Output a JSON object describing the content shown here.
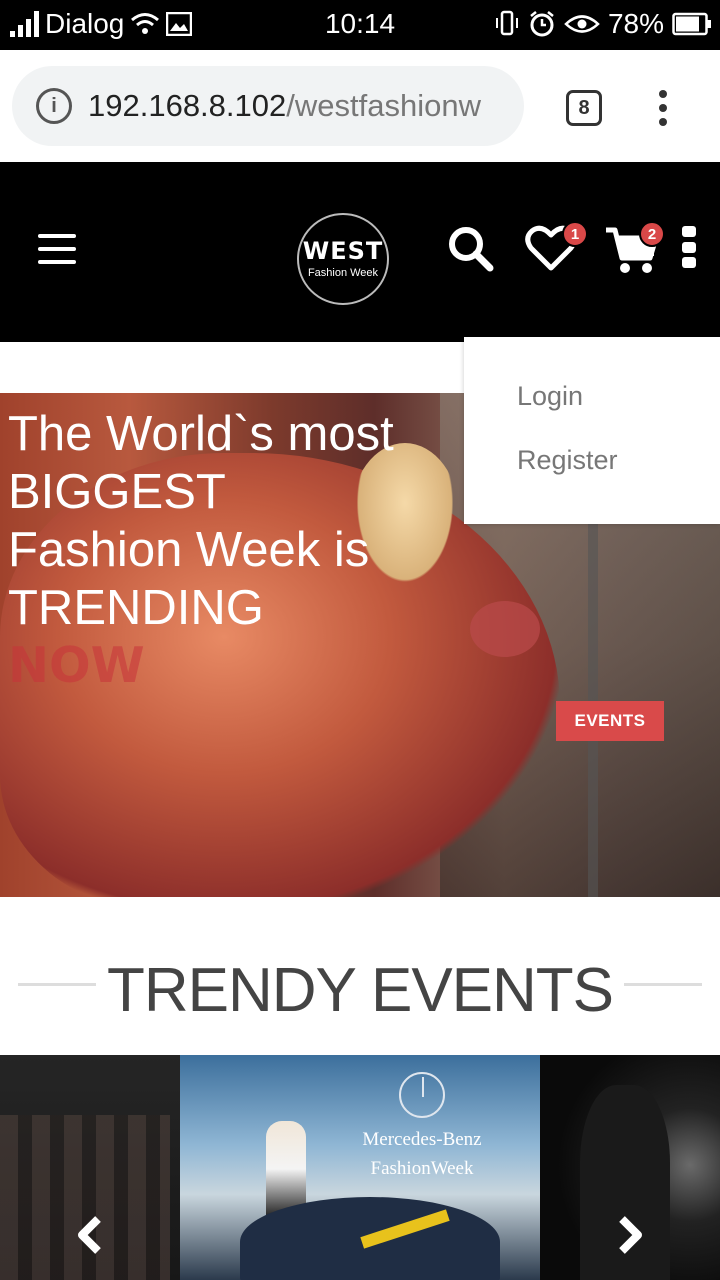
{
  "status_bar": {
    "carrier": "Dialog",
    "time": "10:14",
    "battery": "78%"
  },
  "browser": {
    "url_host": "192.168.8.102",
    "url_path": "/westfashionw",
    "tab_count": "8"
  },
  "header": {
    "logo_line1": "WEST",
    "logo_line2": "Fashion Week",
    "wishlist_count": "1",
    "cart_count": "2"
  },
  "dropdown": {
    "items": [
      {
        "label": "Login"
      },
      {
        "label": "Register"
      }
    ]
  },
  "hero": {
    "line1": "The World`s most",
    "line2": "BIGGEST",
    "line3": "Fashion Week is",
    "line4": "TRENDING",
    "line5": "NOW",
    "button_label": "EVENTS"
  },
  "section": {
    "title": "TRENDY EVENTS"
  },
  "carousel": {
    "center_slide_brand_line1": "Mercedes-Benz",
    "center_slide_brand_line2": "FashionWeek"
  },
  "colors": {
    "accent": "#d94a4a",
    "header_bg": "#000000"
  }
}
